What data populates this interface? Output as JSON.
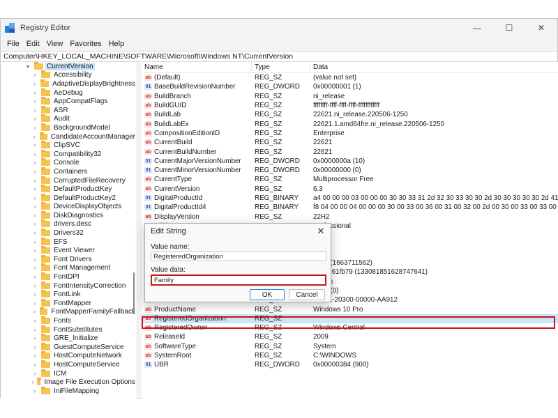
{
  "window": {
    "title": "Registry Editor",
    "controls": {
      "minimize": "—",
      "maximize": "☐",
      "close": "✕"
    }
  },
  "menu": [
    "File",
    "Edit",
    "View",
    "Favorites",
    "Help"
  ],
  "address": "Computer\\HKEY_LOCAL_MACHINE\\SOFTWARE\\Microsoft\\Windows NT\\CurrentVersion",
  "tree": {
    "items": [
      {
        "label": "CurrentVersion",
        "expanded": true,
        "selected": true
      },
      {
        "label": "Accessibility"
      },
      {
        "label": "AdaptiveDisplayBrightness"
      },
      {
        "label": "AeDebug"
      },
      {
        "label": "AppCompatFlags"
      },
      {
        "label": "ASR"
      },
      {
        "label": "Audit"
      },
      {
        "label": "BackgroundModel"
      },
      {
        "label": "CandidateAccountManager"
      },
      {
        "label": "ClipSVC"
      },
      {
        "label": "Compatibility32"
      },
      {
        "label": "Console"
      },
      {
        "label": "Containers"
      },
      {
        "label": "CorruptedFileRecovery"
      },
      {
        "label": "DefaultProductKey"
      },
      {
        "label": "DefaultProductKey2"
      },
      {
        "label": "DeviceDisplayObjects"
      },
      {
        "label": "DiskDiagnostics"
      },
      {
        "label": "drivers.desc"
      },
      {
        "label": "Drivers32"
      },
      {
        "label": "EFS"
      },
      {
        "label": "Event Viewer"
      },
      {
        "label": "Font Drivers"
      },
      {
        "label": "Font Management"
      },
      {
        "label": "FontDPI"
      },
      {
        "label": "FontIntensityCorrection"
      },
      {
        "label": "FontLink"
      },
      {
        "label": "FontMapper"
      },
      {
        "label": "FontMapperFamilyFallback"
      },
      {
        "label": "Fonts"
      },
      {
        "label": "FontSubstitutes"
      },
      {
        "label": "GRE_Initialize"
      },
      {
        "label": "GuestComputeService"
      },
      {
        "label": "HostComputeNetwork"
      },
      {
        "label": "HostComputeService"
      },
      {
        "label": "ICM"
      },
      {
        "label": "Image File Execution Options"
      },
      {
        "label": "IniFileMapping"
      }
    ]
  },
  "list": {
    "headers": {
      "name": "Name",
      "type": "Type",
      "data": "Data"
    },
    "rows": [
      {
        "icon": "ab",
        "name": "(Default)",
        "type": "REG_SZ",
        "data": "(value not set)"
      },
      {
        "icon": "bin",
        "name": "BaseBuildRevisionNumber",
        "type": "REG_DWORD",
        "data": "0x00000001 (1)"
      },
      {
        "icon": "ab",
        "name": "BuildBranch",
        "type": "REG_SZ",
        "data": "ni_release"
      },
      {
        "icon": "ab",
        "name": "BuildGUID",
        "type": "REG_SZ",
        "data": "ffffffff-ffff-ffff-ffff-ffffffffffff"
      },
      {
        "icon": "ab",
        "name": "BuildLab",
        "type": "REG_SZ",
        "data": "22621.ni_release.220506-1250"
      },
      {
        "icon": "ab",
        "name": "BuildLabEx",
        "type": "REG_SZ",
        "data": "22621.1.amd64fre.ni_release.220506-1250"
      },
      {
        "icon": "ab",
        "name": "CompositionEditionID",
        "type": "REG_SZ",
        "data": "Enterprise"
      },
      {
        "icon": "ab",
        "name": "CurrentBuild",
        "type": "REG_SZ",
        "data": "22621"
      },
      {
        "icon": "ab",
        "name": "CurrentBuildNumber",
        "type": "REG_SZ",
        "data": "22621"
      },
      {
        "icon": "bin",
        "name": "CurrentMajorVersionNumber",
        "type": "REG_DWORD",
        "data": "0x0000000a (10)"
      },
      {
        "icon": "bin",
        "name": "CurrentMinorVersionNumber",
        "type": "REG_DWORD",
        "data": "0x00000000 (0)"
      },
      {
        "icon": "ab",
        "name": "CurrentType",
        "type": "REG_SZ",
        "data": "Multiprocessor Free"
      },
      {
        "icon": "ab",
        "name": "CurrentVersion",
        "type": "REG_SZ",
        "data": "6.3"
      },
      {
        "icon": "bin",
        "name": "DigitalProductId",
        "type": "REG_BINARY",
        "data": "a4 00 00 00 03 00 00 00 30 30 33 31 2d 32 30 33 30 30 2d 30 30 30 30 30 2d 41 41 39 31 32 00 f0 0"
      },
      {
        "icon": "bin",
        "name": "DigitalProductId4",
        "type": "REG_BINARY",
        "data": "f8 04 00 00 04 00 00 00 30 00 33 00 36 00 31 00 32 00 2d 00 30 00 33 00 33 00 31 00 32 00 2d 00 30 0"
      },
      {
        "icon": "ab",
        "name": "DisplayVersion",
        "type": "REG_SZ",
        "data": "22H2"
      },
      {
        "icon": "ab",
        "name": "EditionID",
        "type": "REG_SZ",
        "data": "Professional"
      },
      {
        "icon": "ab",
        "name": "",
        "type": "",
        "data": ""
      },
      {
        "icon": "ab",
        "name": "",
        "type": "",
        "data": ""
      },
      {
        "icon": "ab",
        "name": "",
        "type": "",
        "data": ""
      },
      {
        "icon": "ab",
        "name": "",
        "type": "",
        "data": "394a (1663711562)"
      },
      {
        "icon": "ab",
        "name": "",
        "type": "",
        "data": "d3d2c61fb79 (133081851628747641)"
      },
      {
        "icon": "ab",
        "name": "",
        "type": "",
        "data": "ndows"
      },
      {
        "icon": "ab",
        "name": "",
        "type": "",
        "data": "0000 (0)"
      },
      {
        "icon": "ab",
        "name": "ProductId",
        "type": "REG_SZ",
        "data": "00331-20300-00000-AA912"
      },
      {
        "icon": "ab",
        "name": "ProductName",
        "type": "REG_SZ",
        "data": "Windows 10 Pro"
      },
      {
        "icon": "ab",
        "name": "RegisteredOrganization",
        "type": "REG_SZ",
        "data": "",
        "selected": true
      },
      {
        "icon": "ab",
        "name": "RegisteredOwner",
        "type": "REG_SZ",
        "data": "Windows Central"
      },
      {
        "icon": "ab",
        "name": "ReleaseId",
        "type": "REG_SZ",
        "data": "2009"
      },
      {
        "icon": "ab",
        "name": "SoftwareType",
        "type": "REG_SZ",
        "data": "System"
      },
      {
        "icon": "ab",
        "name": "SystemRoot",
        "type": "REG_SZ",
        "data": "C:\\WINDOWS"
      },
      {
        "icon": "bin",
        "name": "UBR",
        "type": "REG_DWORD",
        "data": "0x00000384 (900)"
      }
    ]
  },
  "dialog": {
    "title": "Edit String",
    "close": "✕",
    "value_name_label": "Value name:",
    "value_name": "RegisteredOrganization",
    "value_data_label": "Value data:",
    "value_data": "Family",
    "ok": "OK",
    "cancel": "Cancel"
  },
  "colors": {
    "highlight": "#c4161c",
    "selection": "#cce4f7",
    "folder": "#f4c44f"
  }
}
